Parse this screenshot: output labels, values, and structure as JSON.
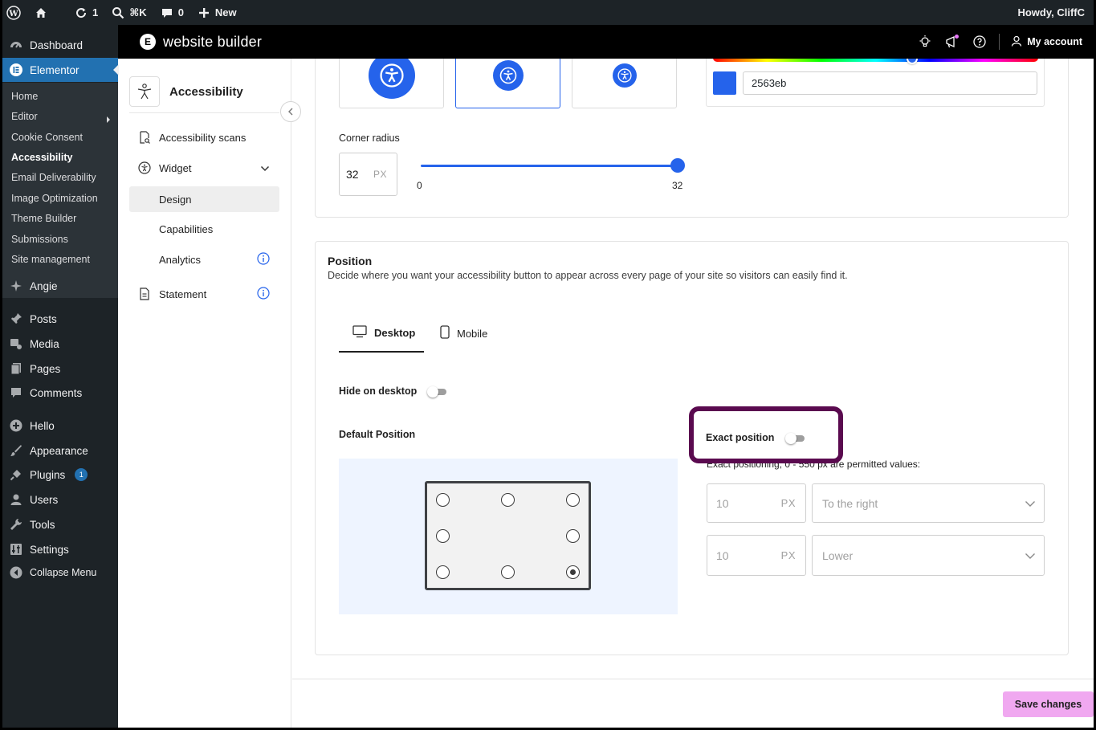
{
  "adminbar": {
    "updates_count": "1",
    "search_shortcut": "⌘K",
    "comments_count": "0",
    "new_label": "New",
    "howdy": "Howdy, CliffC"
  },
  "wp_menu": {
    "dashboard": "Dashboard",
    "elementor": "Elementor",
    "submenu": [
      "Home",
      "Editor",
      "Cookie Consent",
      "Accessibility",
      "Email Deliverability",
      "Image Optimization",
      "Theme Builder",
      "Submissions",
      "Site management"
    ],
    "angie": "Angie",
    "posts": "Posts",
    "media": "Media",
    "pages": "Pages",
    "comments": "Comments",
    "hello": "Hello",
    "appearance": "Appearance",
    "plugins": "Plugins",
    "plugins_badge": "1",
    "users": "Users",
    "tools": "Tools",
    "settings": "Settings",
    "collapse": "Collapse Menu"
  },
  "topbar": {
    "logo_letter": "E",
    "title": "website builder",
    "account": "My account"
  },
  "plugin_nav": {
    "title": "Accessibility",
    "items": {
      "scans": "Accessibility scans",
      "widget": "Widget",
      "design": "Design",
      "capabilities": "Capabilities",
      "analytics": "Analytics",
      "statement": "Statement"
    }
  },
  "design": {
    "color_hex": "2563eb",
    "accent": "#2563eb",
    "corner_radius_label": "Corner radius",
    "corner_radius_value": "32",
    "unit": "PX",
    "slider_min": "0",
    "slider_max": "32"
  },
  "position": {
    "title": "Position",
    "description": "Decide where you want your accessibility button to appear across every page of your site so visitors can easily find it.",
    "tabs": [
      "Desktop",
      "Mobile"
    ],
    "hide_on_desktop": "Hide on desktop",
    "default_position": "Default Position",
    "exact_position": "Exact position",
    "exact_note": "Exact positioning, 0 - 550 px are permitted values:",
    "horizontal_value": "10",
    "horizontal_dir": "To the right",
    "vertical_value": "10",
    "vertical_dir": "Lower"
  },
  "save_button": "Save changes"
}
